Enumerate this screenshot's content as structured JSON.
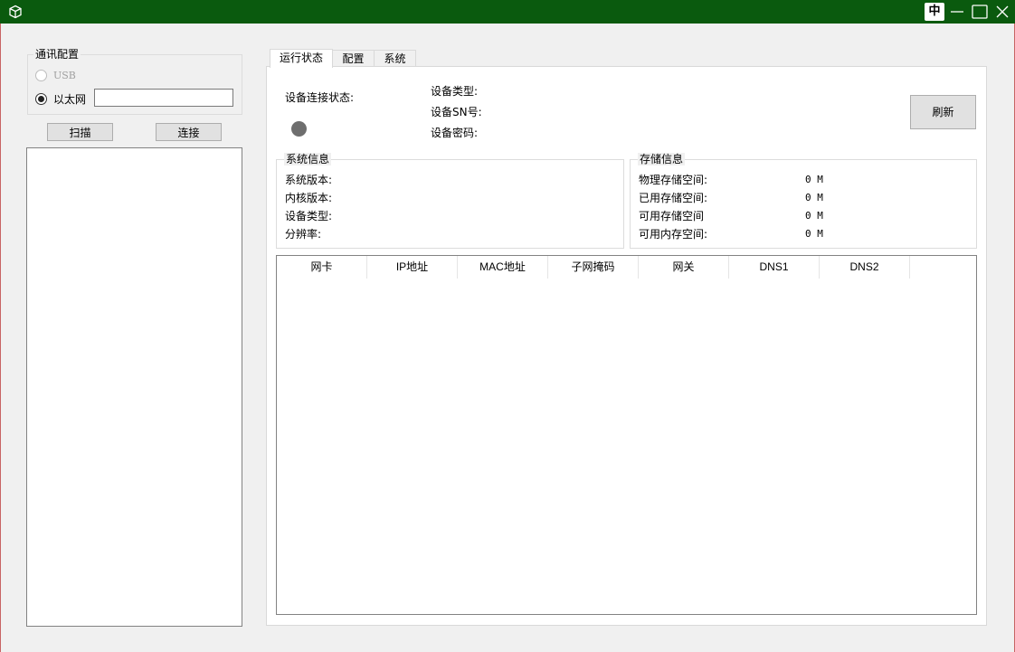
{
  "titlebar": {
    "ime_indicator": "中",
    "icons": {
      "app": "cube-icon",
      "minimize": "minimize-icon",
      "maximize": "maximize-icon",
      "close": "close-icon"
    }
  },
  "comm_config": {
    "legend": "通讯配置",
    "usb_label": "USB",
    "ethernet_label": "以太网",
    "ip_value": "",
    "scan_button": "扫描",
    "connect_button": "连接"
  },
  "tabs": [
    {
      "label": "运行状态",
      "active": true
    },
    {
      "label": "配置",
      "active": false
    },
    {
      "label": "系统",
      "active": false
    }
  ],
  "status": {
    "connection_label": "设备连接状态:",
    "connection_color": "#6e6e6e",
    "device_type_label": "设备类型:",
    "device_sn_label": "设备SN号:",
    "device_password_label": "设备密码:",
    "refresh_button": "刷新"
  },
  "system_info": {
    "legend": "系统信息",
    "items": [
      "系统版本:",
      "内核版本:",
      "设备类型:",
      "分辨率:"
    ]
  },
  "storage_info": {
    "legend": "存储信息",
    "items": [
      {
        "label": "物理存储空间:",
        "value": "0 M"
      },
      {
        "label": "已用存储空间:",
        "value": "0 M"
      },
      {
        "label": "可用存储空间",
        "value": "0 M"
      },
      {
        "label": "可用内存空间:",
        "value": "0 M"
      }
    ]
  },
  "network_table": {
    "columns": [
      "网卡",
      "IP地址",
      "MAC地址",
      "子网掩码",
      "网关",
      "DNS1",
      "DNS2"
    ]
  }
}
